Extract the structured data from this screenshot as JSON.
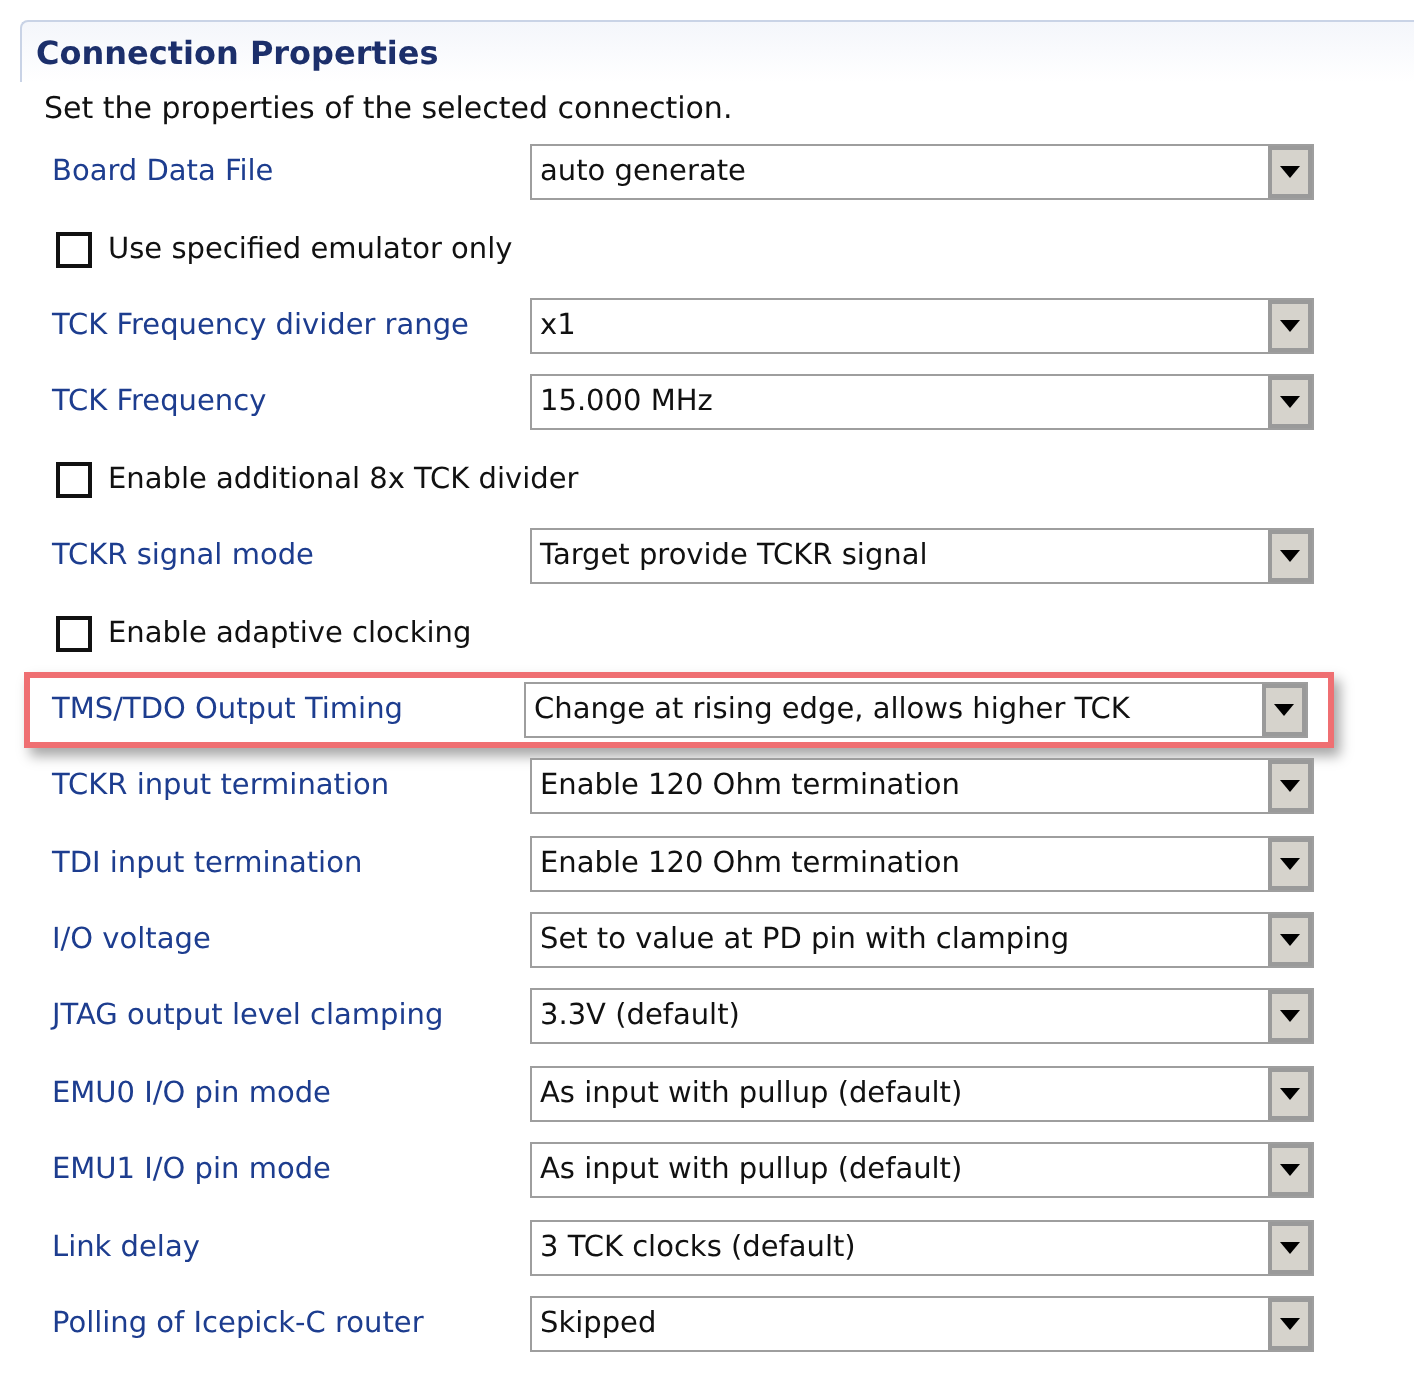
{
  "section": {
    "title": "Connection Properties",
    "description": "Set the properties of the selected connection."
  },
  "rows": [
    {
      "kind": "combo",
      "label": "Board Data File",
      "value": "auto generate",
      "highlighted": false
    },
    {
      "kind": "checkbox",
      "label": "Use specified emulator only",
      "checked": false
    },
    {
      "kind": "combo",
      "label": "TCK Frequency divider range",
      "value": "x1",
      "highlighted": false
    },
    {
      "kind": "combo",
      "label": "TCK Frequency",
      "value": "15.000 MHz",
      "highlighted": false
    },
    {
      "kind": "checkbox",
      "label": "Enable additional 8x TCK divider",
      "checked": false
    },
    {
      "kind": "combo",
      "label": "TCKR signal mode",
      "value": "Target provide TCKR signal",
      "highlighted": false
    },
    {
      "kind": "checkbox",
      "label": "Enable adaptive clocking",
      "checked": false
    },
    {
      "kind": "combo",
      "label": "TMS/TDO Output Timing",
      "value": "Change at rising edge, allows higher TCK",
      "highlighted": true
    },
    {
      "kind": "combo",
      "label": "TCKR input termination",
      "value": "Enable 120 Ohm termination",
      "highlighted": false
    },
    {
      "kind": "combo",
      "label": "TDI input termination",
      "value": "Enable 120 Ohm termination",
      "highlighted": false
    },
    {
      "kind": "combo",
      "label": "I/O voltage",
      "value": "Set to value at PD pin with clamping",
      "highlighted": false
    },
    {
      "kind": "combo",
      "label": "JTAG output level clamping",
      "value": "3.3V (default)",
      "highlighted": false
    },
    {
      "kind": "combo",
      "label": "EMU0 I/O pin mode",
      "value": "As input with pullup (default)",
      "highlighted": false
    },
    {
      "kind": "combo",
      "label": "EMU1 I/O pin mode",
      "value": "As input with pullup (default)",
      "highlighted": false
    },
    {
      "kind": "combo",
      "label": "Link delay",
      "value": "3 TCK clocks (default)",
      "highlighted": false
    },
    {
      "kind": "combo",
      "label": "Polling of Icepick-C router",
      "value": "Skipped",
      "highlighted": false
    }
  ]
}
